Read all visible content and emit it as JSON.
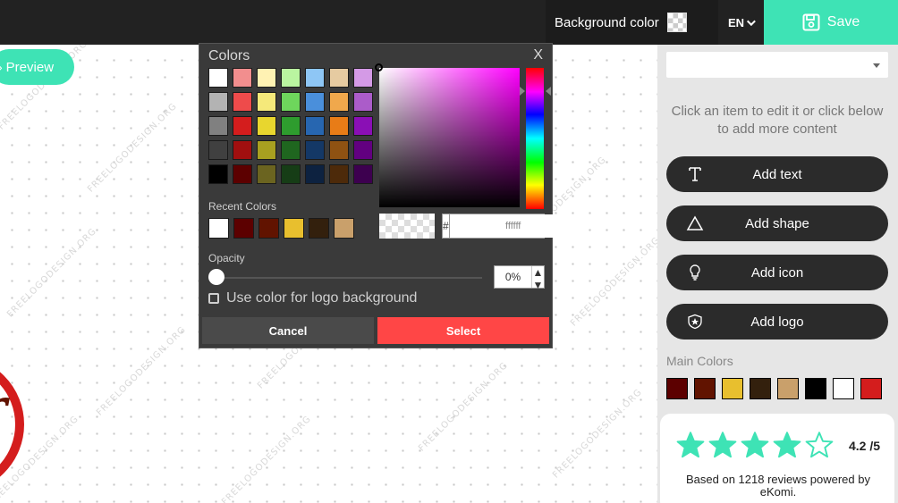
{
  "topbar": {
    "background_color_label": "Background color",
    "language": "EN",
    "save_label": "Save",
    "accent": "#3ee3b5"
  },
  "canvas": {
    "preview_label": "Preview",
    "watermark": "FREELOGODESIGN.ORG",
    "logo_text": "r"
  },
  "picker": {
    "title": "Colors",
    "close": "X",
    "palette": [
      "#ffffff",
      "#f28e8e",
      "#fff2b3",
      "#baf5a0",
      "#8ec6f5",
      "#e6cba1",
      "#d49ae6",
      "#b3b3b3",
      "#ee4b4b",
      "#f5e97a",
      "#6ed65c",
      "#4a8fdb",
      "#f0a84c",
      "#ab5cc9",
      "#808080",
      "#d41d1d",
      "#e8d62e",
      "#2e9c2e",
      "#2766b0",
      "#e87c17",
      "#8a0fb5",
      "#404040",
      "#a10f0f",
      "#a8a020",
      "#1f661f",
      "#143866",
      "#8f5212",
      "#620080",
      "#000000",
      "#5c0000",
      "#6b6420",
      "#163d16",
      "#0d2240",
      "#4d2a0a",
      "#3d004f"
    ],
    "recent_label": "Recent Colors",
    "recent": [
      "#ffffff",
      "#5c0000",
      "#611300",
      "#e8bf2e",
      "#33200d",
      "#c9a06b"
    ],
    "hex_hash": "#",
    "hex_value": "ffffff",
    "opacity_label": "Opacity",
    "opacity_value": "0%",
    "use_for_background": "Use color for logo background",
    "cancel": "Cancel",
    "select": "Select",
    "hue_color": "#ff00ff"
  },
  "panel": {
    "dropdown_value": "",
    "hint": "Click an item to edit it or click below to add more content",
    "actions": [
      {
        "label": "Add text",
        "icon": "text-icon"
      },
      {
        "label": "Add shape",
        "icon": "triangle-icon"
      },
      {
        "label": "Add icon",
        "icon": "lightbulb-icon"
      },
      {
        "label": "Add logo",
        "icon": "shield-star-icon"
      }
    ],
    "main_colors_label": "Main Colors",
    "main_colors": [
      "#5c0000",
      "#611300",
      "#e8bf2e",
      "#33200d",
      "#c9a06b",
      "#000000",
      "#ffffff",
      "#d41d1d"
    ]
  },
  "reviews": {
    "rating": "4.2 /5",
    "stars_filled": 4,
    "stars_total": 5,
    "text": "Based on 1218 reviews powered by eKomi.",
    "star_color": "#3ee3b5"
  }
}
